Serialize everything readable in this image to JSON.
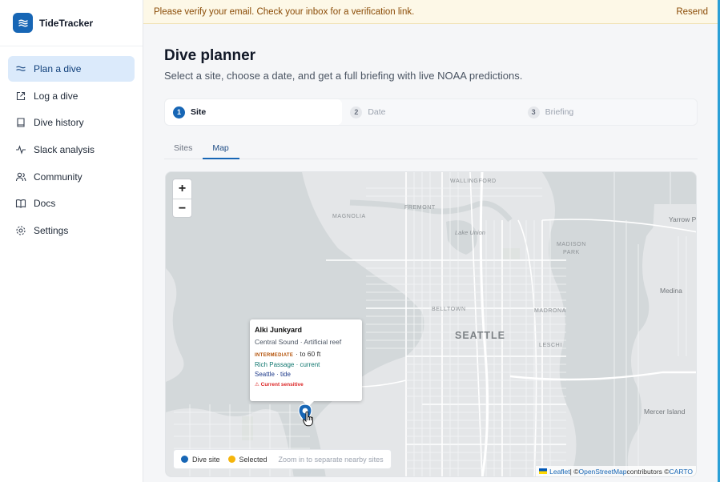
{
  "app": {
    "name": "TideTracker"
  },
  "sidebar": {
    "items": [
      {
        "label": "Plan a dive",
        "icon": "waves-icon",
        "active": true
      },
      {
        "label": "Log a dive",
        "icon": "external-link-icon"
      },
      {
        "label": "Dive history",
        "icon": "book-icon"
      },
      {
        "label": "Slack analysis",
        "icon": "activity-icon"
      },
      {
        "label": "Community",
        "icon": "users-icon"
      },
      {
        "label": "Docs",
        "icon": "open-book-icon"
      },
      {
        "label": "Settings",
        "icon": "gear-icon"
      }
    ]
  },
  "banner": {
    "message": "Please verify your email. Check your inbox for a verification link.",
    "action": "Resend"
  },
  "page": {
    "title": "Dive planner",
    "subtitle": "Select a site, choose a date, and get a full briefing with live NOAA predictions."
  },
  "stepper": [
    {
      "num": "1",
      "label": "Site",
      "active": true
    },
    {
      "num": "2",
      "label": "Date"
    },
    {
      "num": "3",
      "label": "Briefing"
    }
  ],
  "tabs": [
    {
      "label": "Sites"
    },
    {
      "label": "Map",
      "active": true
    }
  ],
  "map": {
    "labels": {
      "wallingford": "WALLINGFORD",
      "fremont": "FREMONT",
      "magnolia": "MAGNOLIA",
      "lake_union": "Lake Union",
      "madison_park": "MADISON\nPARK",
      "yarrow_point": "Yarrow Pc",
      "belltown": "BELLTOWN",
      "madrona": "MADRONA",
      "medina": "Medina",
      "seattle": "SEATTLE",
      "leschi": "LESCHI",
      "mercer_island": "Mercer Island"
    },
    "zoom_in": "+",
    "zoom_out": "−",
    "popup": {
      "title": "Alki Junkyard",
      "subtitle": "Central Sound · Artificial reef",
      "level_badge": "INTERMEDIATE",
      "depth": "· to 60 ft",
      "current_station": "Rich Passage · current",
      "tide_station": "Seattle · tide",
      "warning": "⚠ Current sensitive"
    },
    "legend": {
      "dive_site": "Dive site",
      "selected": "Selected",
      "hint": "Zoom in to separate nearby sites",
      "dive_site_color": "#1766b5",
      "selected_color": "#f5b50c"
    },
    "attribution": {
      "leaflet": "Leaflet",
      "sep1": " | © ",
      "osm": "OpenStreetMap",
      "mid": " contributors © ",
      "carto": "CARTO"
    }
  },
  "colors": {
    "accent": "#1766b5",
    "banner_bg": "#fdf8e7",
    "banner_text": "#8a4b06"
  }
}
